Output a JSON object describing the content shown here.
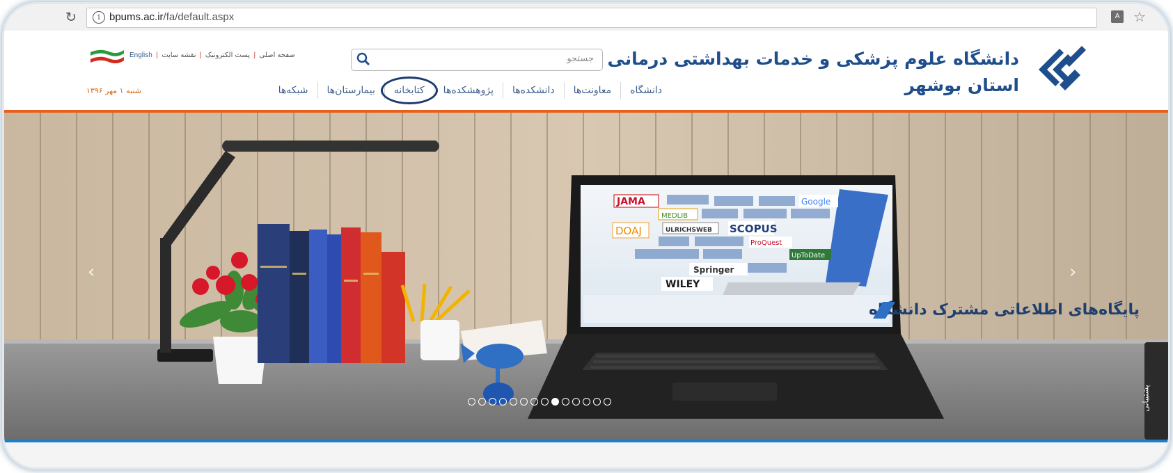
{
  "browser": {
    "url_domain": "bpums.ac.ir",
    "url_path": "/fa/default.aspx",
    "reload_icon": "reload-icon",
    "info_icon": "info-icon"
  },
  "header": {
    "university_name_line1": "دانشگاه علوم پزشکی و خدمات بهداشتی درمانی",
    "university_name_line2": "استان بوشهر",
    "search_placeholder": "جستجو",
    "top_links": [
      "صفحه اصلی",
      "پست الکترونیک",
      "نقشه سایت",
      "English"
    ],
    "date": "شنبه ۱ مهر ۱۳۹۶"
  },
  "menu": [
    {
      "label": "دانشگاه"
    },
    {
      "label": "معاونت‌ها"
    },
    {
      "label": "دانشکده‌ها"
    },
    {
      "label": "پژوهشکده‌ها"
    },
    {
      "label": "کتابخانه"
    },
    {
      "label": "بیمارستان‌ها"
    },
    {
      "label": "شبکه‌ها"
    }
  ],
  "slider": {
    "screen_caption": "پایگاه‌های اطلاعاتی مشترک دانشگاه",
    "db_logos": [
      "JAMA",
      "Google",
      "MEDLIB",
      "DOAJ",
      "ULRICHSWEB",
      "SCOPUS",
      "ProQuest",
      "UpToDate",
      "Springer",
      "WILEY"
    ],
    "dot_count": 14,
    "active_dot": 9,
    "side_tab_label": "پشتیبانی"
  },
  "colors": {
    "accent_orange": "#e8601c",
    "brand_blue": "#1f4e8c",
    "bottom_blue": "#1e7fc3"
  }
}
